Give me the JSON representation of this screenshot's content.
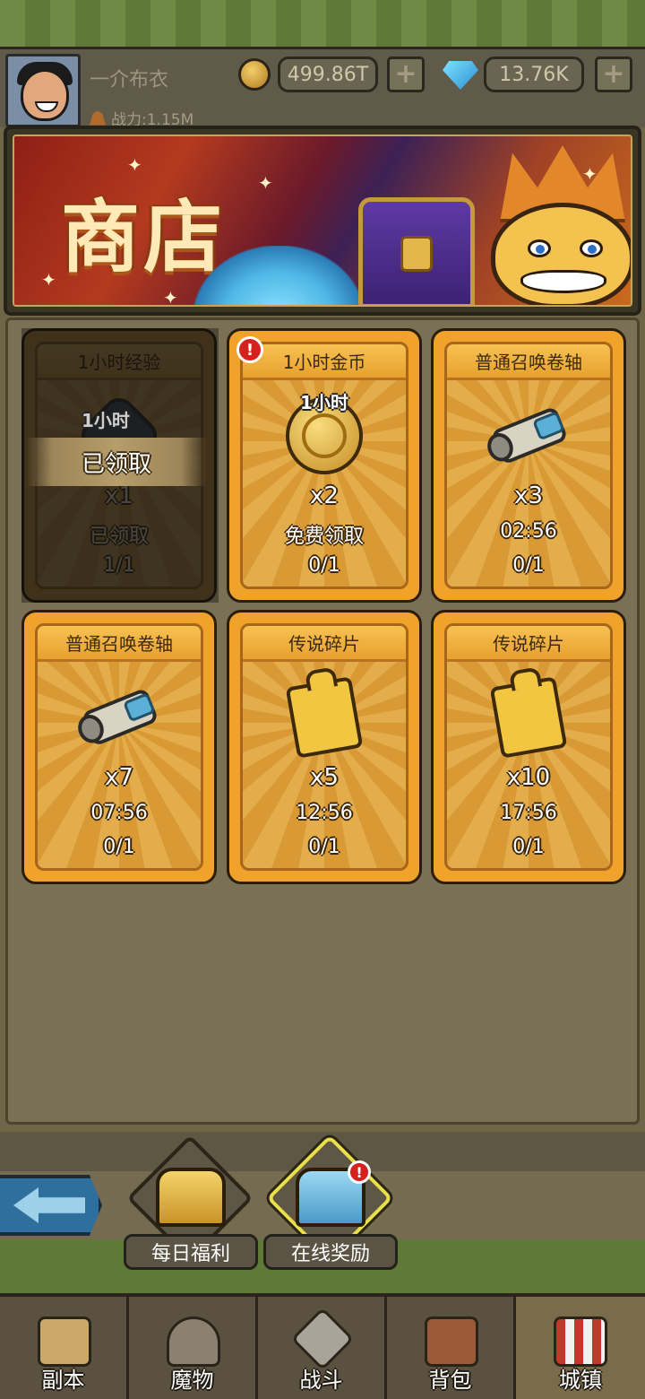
{
  "header": {
    "username": "一介布衣",
    "power": "战力:1.15M",
    "gold": "499.86T",
    "gems": "13.76K",
    "add_label": "+"
  },
  "banner": {
    "title": "商店"
  },
  "shop": {
    "claimed_overlay": "已领取",
    "items": [
      {
        "title": "1小时经验",
        "icon_label": "1小时",
        "qty": "x1",
        "status": "已领取",
        "count": "1/1",
        "icon": "exp-crystal-icon",
        "claimed": true,
        "alert": false
      },
      {
        "title": "1小时金币",
        "icon_label": "1小时",
        "qty": "x2",
        "status": "免费领取",
        "count": "0/1",
        "icon": "gold-coin-icon",
        "claimed": false,
        "alert": true
      },
      {
        "title": "普通召唤卷轴",
        "qty": "x3",
        "status": "02:56",
        "count": "0/1",
        "icon": "scroll-icon",
        "claimed": false,
        "alert": false
      },
      {
        "title": "普通召唤卷轴",
        "qty": "x7",
        "status": "07:56",
        "count": "0/1",
        "icon": "scroll-icon",
        "claimed": false,
        "alert": false
      },
      {
        "title": "传说碎片",
        "qty": "x5",
        "status": "12:56",
        "count": "0/1",
        "icon": "legend-fragment-icon",
        "claimed": false,
        "alert": false
      },
      {
        "title": "传说碎片",
        "qty": "x10",
        "status": "17:56",
        "count": "0/1",
        "icon": "legend-fragment-icon",
        "claimed": false,
        "alert": false
      }
    ]
  },
  "rewards": {
    "daily": {
      "label": "每日福利",
      "icon": "gold-chest-icon"
    },
    "online": {
      "label": "在线奖励",
      "icon": "blue-chest-icon",
      "alert": "!"
    }
  },
  "nav": {
    "tabs": [
      {
        "label": "副本",
        "icon": "map-icon"
      },
      {
        "label": "魔物",
        "icon": "monster-helmet-icon"
      },
      {
        "label": "战斗",
        "icon": "crossed-swords-icon"
      },
      {
        "label": "背包",
        "icon": "backpack-icon"
      },
      {
        "label": "城镇",
        "icon": "town-shop-icon"
      }
    ],
    "active_index": 4
  },
  "colors": {
    "card_gold": "#f0a22a",
    "alert_red": "#d6221e",
    "active_highlight": "#e8e04a"
  }
}
